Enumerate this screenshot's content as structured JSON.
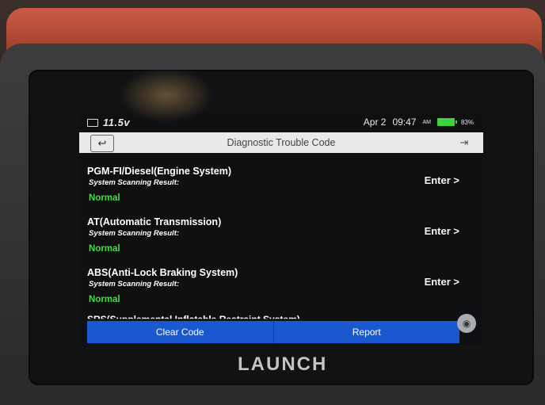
{
  "status": {
    "voltage": "11.5v",
    "date": "Apr 2",
    "time": "09:47",
    "ampm": "AM",
    "battery": "83%"
  },
  "header": {
    "title": "Diagnostic Trouble Code"
  },
  "systems": [
    {
      "name": "PGM-FI/Diesel(Engine System)",
      "sub": "System Scanning Result:",
      "result": "Normal",
      "action": "Enter >"
    },
    {
      "name": "AT(Automatic Transmission)",
      "sub": "System Scanning Result:",
      "result": "Normal",
      "action": "Enter >"
    },
    {
      "name": "ABS(Anti-Lock Braking System)",
      "sub": "System Scanning Result:",
      "result": "Normal",
      "action": "Enter >"
    }
  ],
  "partial_item": "SRS(Supplemental Inflatable Restraint System)",
  "footer": {
    "clear_code": "Clear Code",
    "report": "Report"
  },
  "device": {
    "logo": "LAUNCH"
  },
  "colors": {
    "accent": "#1958cf",
    "normal": "#3ce03c",
    "battery": "#3bd43b"
  }
}
